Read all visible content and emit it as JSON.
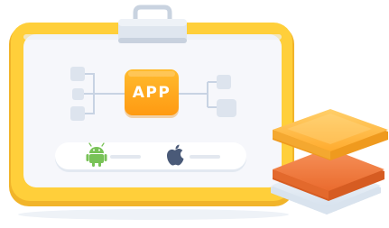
{
  "app_tile": {
    "label": "APP",
    "icon": "app-icon"
  },
  "platforms": [
    {
      "name": "android",
      "icon": "android-icon"
    },
    {
      "name": "apple",
      "icon": "apple-icon"
    }
  ],
  "decor": {
    "clip_icon": "clipboard-clip-icon",
    "stack_icon": "stacked-layers-icon"
  },
  "colors": {
    "board_frame": "#ffcc33",
    "board_inner": "#f6f7fb",
    "app_tile": "#ffa61a",
    "connector": "#c8d3e3",
    "node": "#dfe6f0",
    "android": "#78c257",
    "apple": "#4a5a78",
    "layer_top": "#ffb94a",
    "layer_middle": "#f07a3c",
    "layer_bottom": "#e6eef6"
  }
}
